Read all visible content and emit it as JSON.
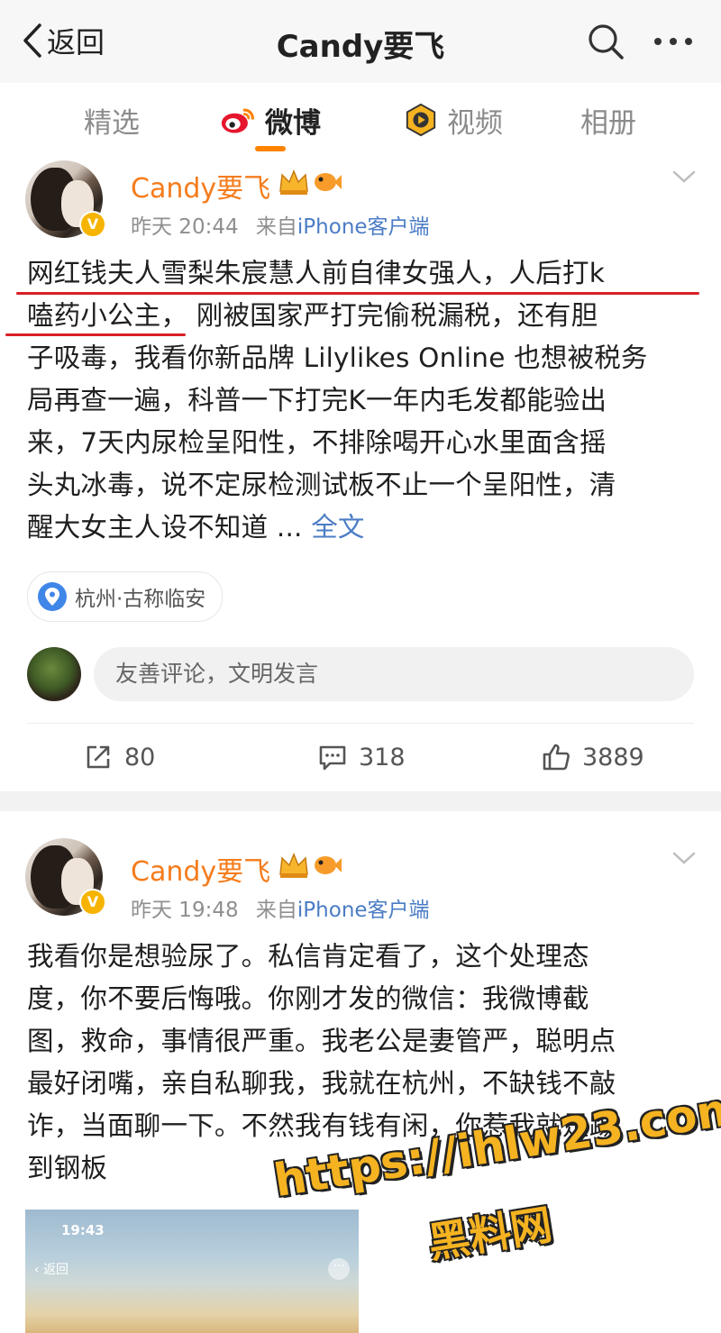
{
  "nav": {
    "back_label": "返回",
    "title": "Candy要飞"
  },
  "tabs": [
    {
      "label": "精选"
    },
    {
      "label": "微博",
      "active": true
    },
    {
      "label": "视频"
    },
    {
      "label": "相册"
    }
  ],
  "colors": {
    "accent": "#ff8200",
    "username": "#f57c1c",
    "link": "#4b7cc5",
    "highlight_underline": "#d91f26",
    "watermark": "#f5b321"
  },
  "posts": [
    {
      "user": "Candy要飞",
      "time": "昨天 20:44",
      "source_prefix": "来自",
      "source": "iPhone客户端",
      "text_lines": [
        "网红钱夫人雪梨朱宸慧人前自律女强人，人后打k",
        "嗑药小公主，  刚被国家严打完偷税漏税，还有胆",
        "子吸毒，我看你新品牌 Lilylikes Online 也想被税务",
        "局再查一遍，科普一下打完K一年内毛发都能验出",
        "来，7天内尿检呈阳性，不排除喝开心水里面含摇",
        "头丸冰毒，说不定尿检测试板不止一个呈阳性，清",
        "醒大女主人设不知道 ... "
      ],
      "more_label": "全文",
      "location": "杭州·古称临安",
      "comment_placeholder": "友善评论，文明发言",
      "reposts": "80",
      "comments": "318",
      "likes": "3889"
    },
    {
      "user": "Candy要飞",
      "time": "昨天 19:48",
      "source_prefix": "来自",
      "source": "iPhone客户端",
      "text_lines": [
        "我看你是想验尿了。私信肯定看了，这个处理态",
        "度，你不要后悔哦。你刚才发的微信：我微博截",
        "图，救命，事情很严重。我老公是妻管严，聪明点",
        "最好闭嘴，亲自私聊我，我就在杭州，不缺钱不敲",
        "诈，当面聊一下。不然我有钱有闲，你惹我就是踢",
        "到钢板"
      ],
      "image": {
        "time": "19:43",
        "back_label": "返回"
      }
    }
  ],
  "watermark": {
    "line1": "https://ihlw23.com",
    "line2": "黑料网"
  }
}
